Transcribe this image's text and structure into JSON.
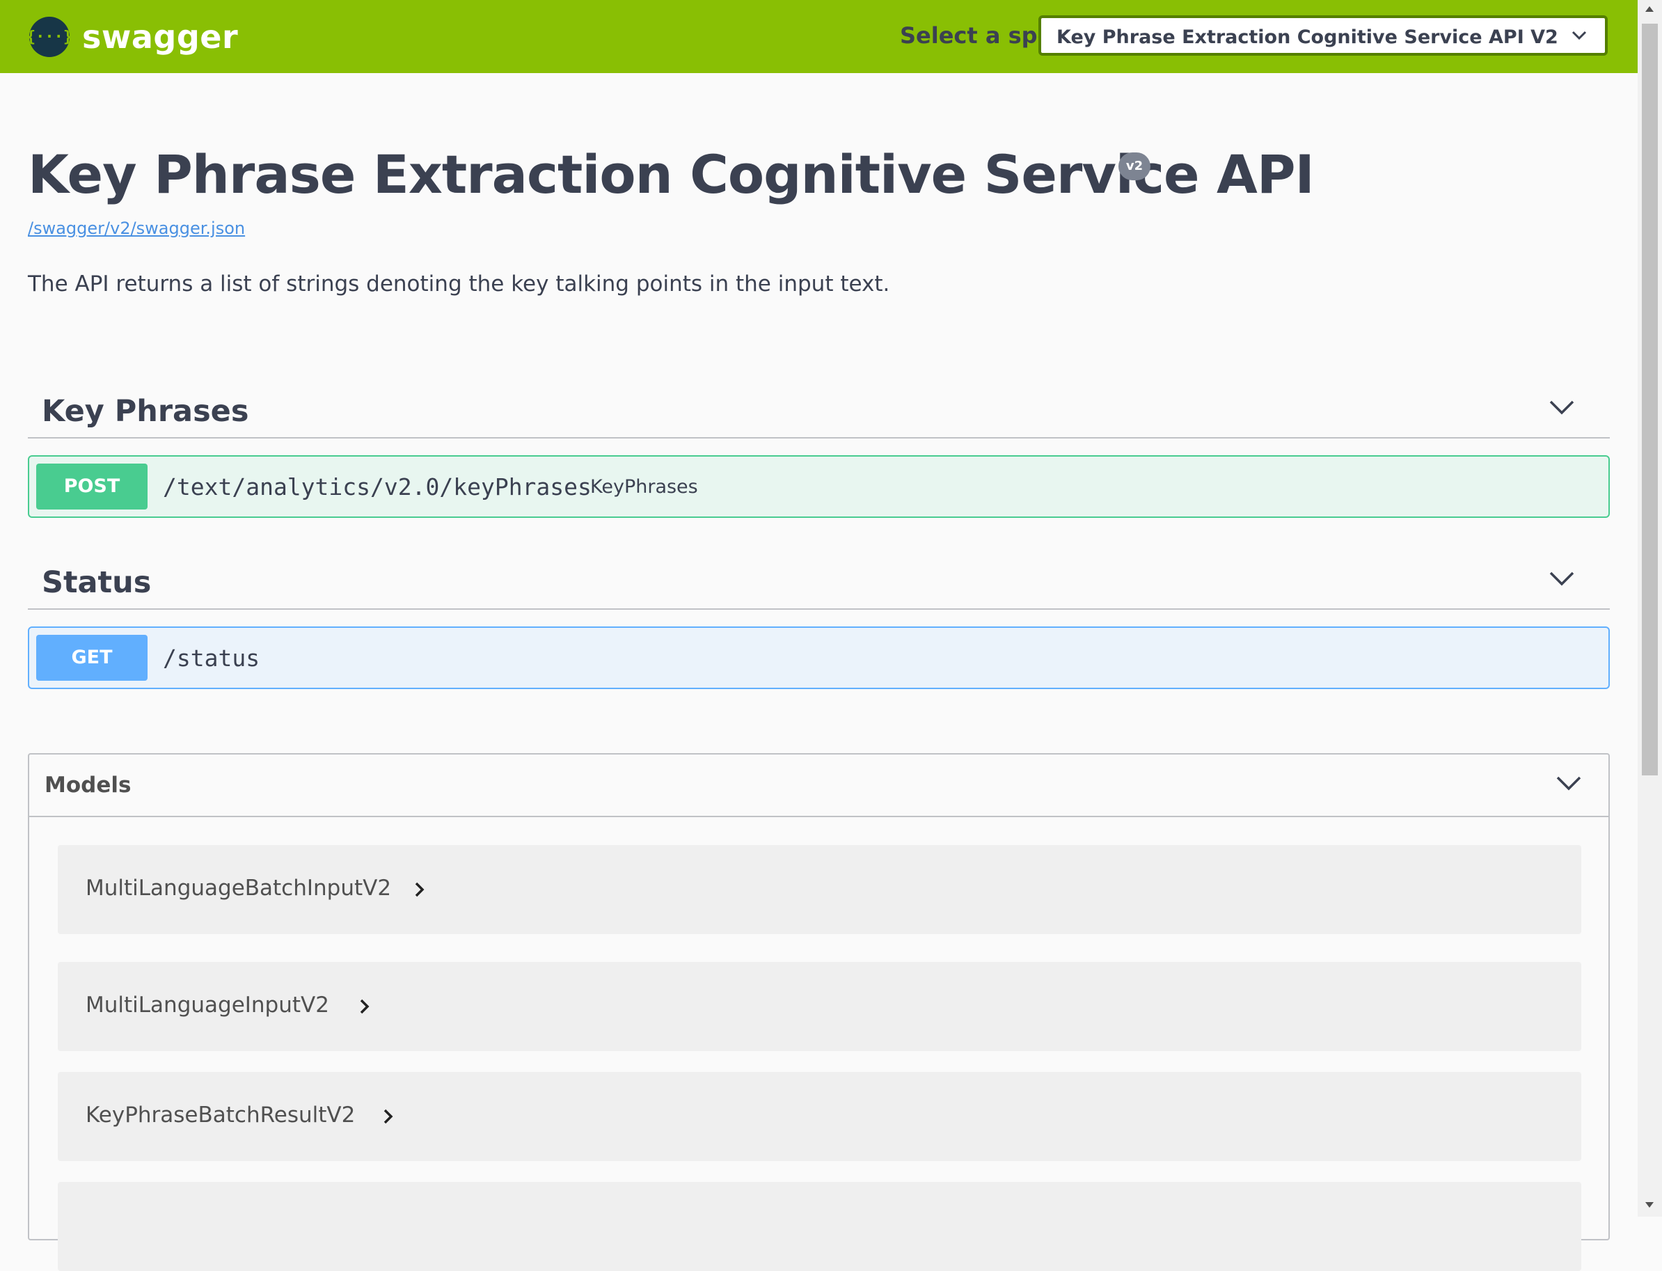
{
  "topbar": {
    "brand": "swagger",
    "logo_glyph": "{···}",
    "spec_label": "Select a spec",
    "spec_selected": "Key Phrase Extraction Cognitive Service API V2"
  },
  "info": {
    "title": "Key Phrase Extraction Cognitive Service API",
    "version": "v2",
    "spec_url": "/swagger/v2/swagger.json",
    "description": "The API returns a list of strings denoting the key talking points in the input text."
  },
  "tags": [
    {
      "name": "Key Phrases",
      "operation": {
        "method": "POST",
        "path": "/text/analytics/v2.0/keyPhrases",
        "summary": "KeyPhrases"
      }
    },
    {
      "name": "Status",
      "operation": {
        "method": "GET",
        "path": "/status",
        "summary": ""
      }
    }
  ],
  "models": {
    "title": "Models",
    "items": [
      "MultiLanguageBatchInputV2",
      "MultiLanguageInputV2",
      "KeyPhraseBatchResultV2"
    ]
  },
  "colors": {
    "topbar": "#89bf04",
    "post": "#49cc90",
    "get": "#61affe",
    "text": "#3b4151",
    "link": "#4990e2"
  }
}
